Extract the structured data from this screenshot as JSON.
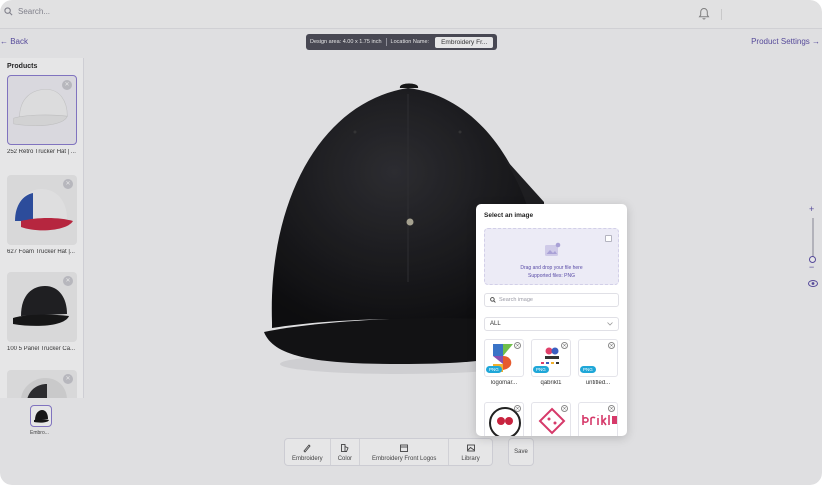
{
  "topbar": {
    "search_placeholder": "Search..."
  },
  "nav": {
    "back_label": "← Back",
    "product_settings_label": "Product Settings →"
  },
  "design_pill": {
    "area_text": "Design area: 4.00 x 1.75 inch",
    "location_label": "Location Name:",
    "location_value": "Embroidery Fr..."
  },
  "products": {
    "title": "Products",
    "items": [
      {
        "name": "252 Retro Trucker Hat | ..."
      },
      {
        "name": "627 Foam Trucker Hat |..."
      },
      {
        "name": "100 5 Panel Trucker Ca..."
      },
      {
        "name": ""
      }
    ]
  },
  "embroidery_thumb": {
    "label": "Embro..."
  },
  "toolbar": {
    "items": [
      {
        "label": "Embroidery",
        "icon": "brush-icon"
      },
      {
        "label": "Color",
        "icon": "palette-icon"
      },
      {
        "label": "Embroidery Front Logos",
        "icon": "archive-icon"
      },
      {
        "label": "Library",
        "icon": "image-icon"
      }
    ],
    "save_label": "Save"
  },
  "modal": {
    "title": "Select an image",
    "drop_text": "Drag and drop your file here",
    "supported_text": "Supported files: PNG",
    "search_placeholder": "Search image",
    "filter_value": "ALL",
    "images": [
      {
        "name": "logomar...",
        "badge": "PNG"
      },
      {
        "name": "qabrikl1",
        "badge": "PNG"
      },
      {
        "name": "untitled...",
        "badge": "PNG"
      },
      {
        "name": "",
        "badge": ""
      },
      {
        "name": "",
        "badge": ""
      },
      {
        "name": "",
        "badge": ""
      }
    ]
  },
  "colors": {
    "accent": "#5a4ca7",
    "badge": "#1fa7d8",
    "cap": "#0b0b0d"
  }
}
